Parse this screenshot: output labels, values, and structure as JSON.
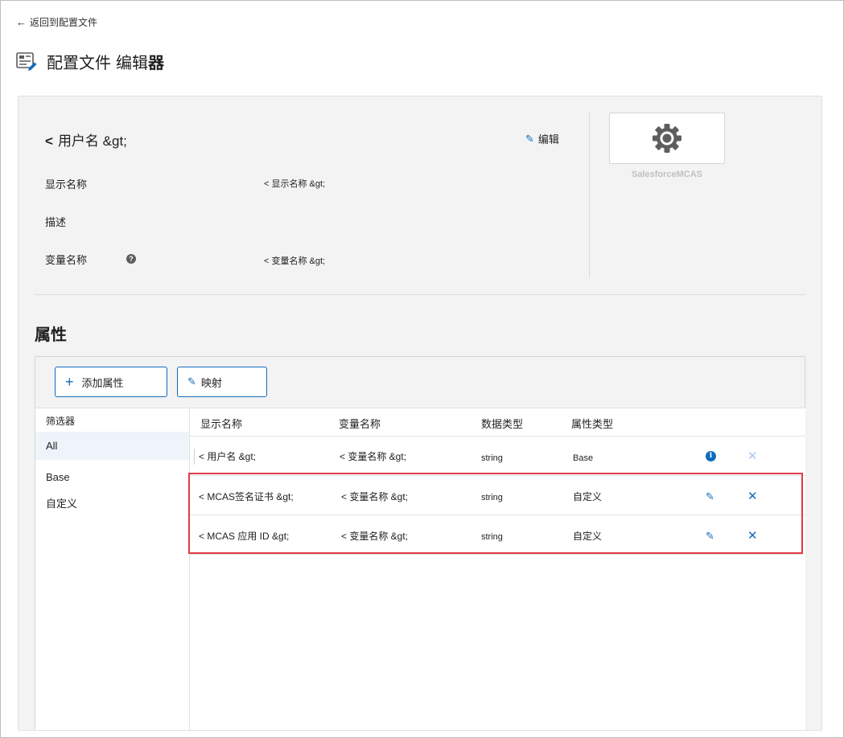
{
  "back_link": {
    "label": "返回到配置文件"
  },
  "header": {
    "title_regular": "配置文件",
    "title_mid": "编辑",
    "title_bold": "器"
  },
  "profile": {
    "title_prefix": "<",
    "title": "用户名 &gt;",
    "edit_label": "编辑",
    "fields": [
      {
        "label": "显示名称",
        "value": "< 显示名称 &gt;"
      },
      {
        "label": "描述",
        "value": ""
      },
      {
        "label": "变量名称",
        "value": "< 变量名称 &gt;",
        "help": "?"
      }
    ]
  },
  "app": {
    "name": "SalesforceMCAS",
    "icon": "gear-icon"
  },
  "attributes": {
    "title": "属性",
    "add_button": "添加属性",
    "map_button": "映射",
    "filter": {
      "header": "筛选器",
      "items": [
        "All",
        "Base",
        "自定义"
      ],
      "selected": "All"
    },
    "columns": [
      "显示名称",
      "变量名称",
      "数据类型",
      "属性类型"
    ],
    "rows": [
      {
        "display_name": "< 用户名 &gt;",
        "variable": "< 变量名称 &gt;",
        "data_type": "string",
        "attr_type": "Base",
        "action": "info-icon",
        "delete_enabled": false
      },
      {
        "display_name": "< MCAS签名证书 &gt;",
        "variable": "< 变量名称 &gt;",
        "data_type": "string",
        "attr_type": "自定义",
        "action": "pencil-icon",
        "delete_enabled": true
      },
      {
        "display_name": "< MCAS 应用 ID &gt;",
        "variable": "< 变量名称 &gt;",
        "data_type": "string",
        "attr_type": "自定义",
        "action": "pencil-icon",
        "delete_enabled": true
      }
    ]
  },
  "colors": {
    "accent": "#0f6cbd",
    "highlight": "#e33b46",
    "panel_bg": "#f3f3f3"
  }
}
